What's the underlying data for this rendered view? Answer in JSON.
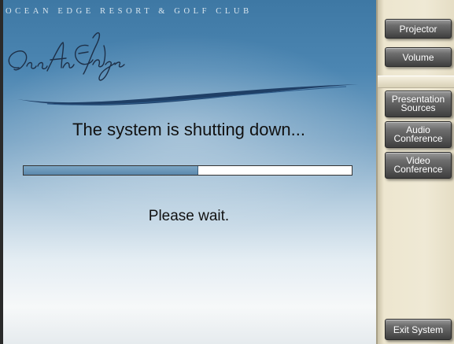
{
  "brand": {
    "name_line": "OCEAN EDGE RESORT & GOLF CLUB",
    "logo_script": "OceAn Edge"
  },
  "main": {
    "status_title": "The system is shutting down...",
    "progress_fraction": 0.53,
    "wait_message": "Please wait."
  },
  "sidebar": {
    "projector": "Projector",
    "volume": "Volume",
    "presentation_1": "Presentation",
    "presentation_2": "Sources",
    "audio_1": "Audio",
    "audio_2": "Conference",
    "video_1": "Video",
    "video_2": "Conference",
    "exit": "Exit System"
  },
  "colors": {
    "main_blue": "#3e78a4",
    "side_panel": "#efe9d5",
    "button_dark": "#3f3f3f"
  }
}
